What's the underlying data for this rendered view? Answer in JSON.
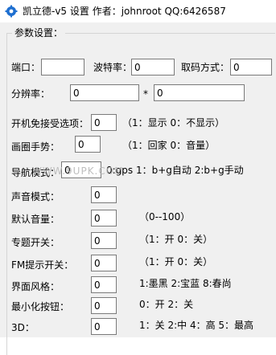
{
  "window": {
    "title": "凯立德-v5 设置  作者：johnroot  QQ:6426587",
    "icon": "gear-icon",
    "icon_color": "#1e6fd0"
  },
  "group": {
    "title": "参数设置："
  },
  "port": {
    "label": "端口：",
    "value": ""
  },
  "baud": {
    "label": "波特率：",
    "value": "0"
  },
  "decode": {
    "label": "取码方式：",
    "value": "0"
  },
  "resolution": {
    "label": "分辨率：",
    "width": "0",
    "sep": "*",
    "height": "0"
  },
  "boot_skip": {
    "label": "开机免接受选项：",
    "value": "0",
    "hint": "（1：显示 0：不显示）"
  },
  "gesture": {
    "label": "画圈手势：",
    "value": "0",
    "hint": "（1：回家 0：音量）"
  },
  "nav_mode": {
    "label": "导航模式：",
    "value": "0",
    "hint": "0:gps  1：b+g自动  2:b+g手动"
  },
  "watermark": "WWW.9UPK.COM",
  "voice_mode": {
    "label": "声音模式：",
    "value": "0"
  },
  "default_volume": {
    "label": "默认音量：",
    "value": "0",
    "hint": "（0--100）"
  },
  "topic_switch": {
    "label": "专题开关：",
    "value": "0",
    "hint": "（1：开 0：关）"
  },
  "fm_switch": {
    "label": "FM提示开关：",
    "value": "0",
    "hint": "（1：开 0：关）"
  },
  "ui_style": {
    "label": "界面风格：",
    "value": "0",
    "hint": "1:墨黑  2:宝蓝  8:春尚"
  },
  "minimize": {
    "label": "最小化按钮：",
    "value": "0",
    "hint": "0：开 2：关"
  },
  "threed": {
    "label": "3D：",
    "value": "0",
    "hint": "1：关 2:中 4：高 5：最高"
  }
}
